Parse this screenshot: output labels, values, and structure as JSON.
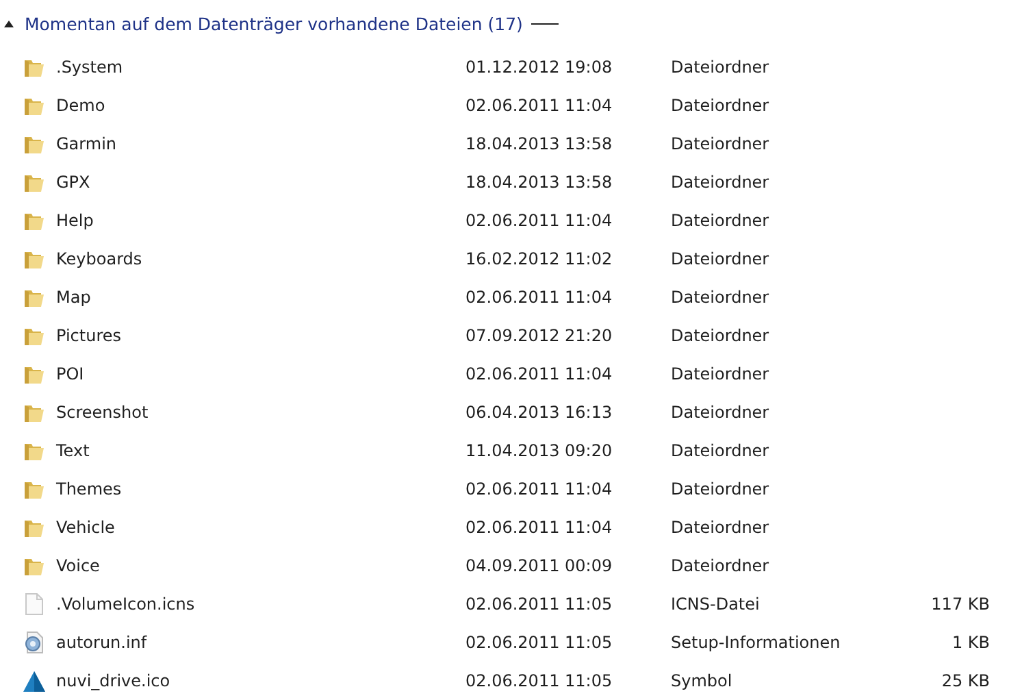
{
  "group": {
    "title": "Momentan auf dem Datenträger vorhandene Dateien (17)",
    "expanded": true
  },
  "rows": [
    {
      "kind": "folder",
      "name": ".System",
      "date": "01.12.2012 19:08",
      "type": "Dateiordner"
    },
    {
      "kind": "folder",
      "name": "Demo",
      "date": "02.06.2011 11:04",
      "type": "Dateiordner"
    },
    {
      "kind": "folder",
      "name": "Garmin",
      "date": "18.04.2013 13:58",
      "type": "Dateiordner"
    },
    {
      "kind": "folder",
      "name": "GPX",
      "date": "18.04.2013 13:58",
      "type": "Dateiordner"
    },
    {
      "kind": "folder",
      "name": "Help",
      "date": "02.06.2011 11:04",
      "type": "Dateiordner"
    },
    {
      "kind": "folder",
      "name": "Keyboards",
      "date": "16.02.2012 11:02",
      "type": "Dateiordner"
    },
    {
      "kind": "folder",
      "name": "Map",
      "date": "02.06.2011 11:04",
      "type": "Dateiordner"
    },
    {
      "kind": "folder",
      "name": "Pictures",
      "date": "07.09.2012 21:20",
      "type": "Dateiordner"
    },
    {
      "kind": "folder",
      "name": "POI",
      "date": "02.06.2011 11:04",
      "type": "Dateiordner"
    },
    {
      "kind": "folder",
      "name": "Screenshot",
      "date": "06.04.2013 16:13",
      "type": "Dateiordner"
    },
    {
      "kind": "folder",
      "name": "Text",
      "date": "11.04.2013 09:20",
      "type": "Dateiordner"
    },
    {
      "kind": "folder",
      "name": "Themes",
      "date": "02.06.2011 11:04",
      "type": "Dateiordner"
    },
    {
      "kind": "folder",
      "name": "Vehicle",
      "date": "02.06.2011 11:04",
      "type": "Dateiordner"
    },
    {
      "kind": "folder",
      "name": "Voice",
      "date": "04.09.2011 00:09",
      "type": "Dateiordner"
    },
    {
      "kind": "file",
      "name": ".VolumeIcon.icns",
      "date": "02.06.2011 11:05",
      "type": "ICNS-Datei",
      "size": "117 KB"
    },
    {
      "kind": "settings",
      "name": "autorun.inf",
      "date": "02.06.2011 11:05",
      "type": "Setup-Informationen",
      "size": "1 KB"
    },
    {
      "kind": "symbol",
      "name": "nuvi_drive.ico",
      "date": "02.06.2011 11:05",
      "type": "Symbol",
      "size": "25 KB"
    }
  ]
}
